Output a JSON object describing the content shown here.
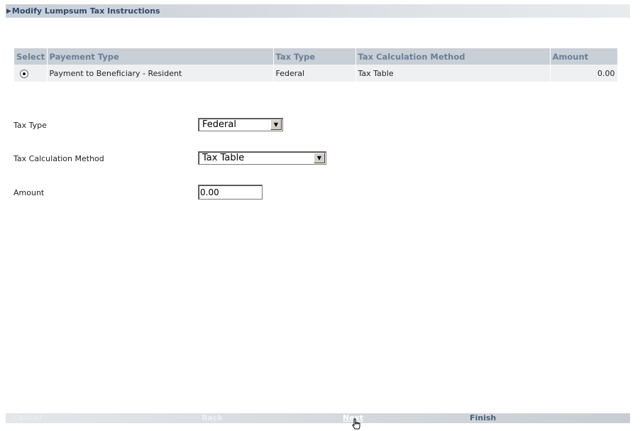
{
  "page": {
    "title": "Modify Lumpsum Tax Instructions"
  },
  "grid": {
    "headers": [
      "Select",
      "Payement Type",
      "Tax Type",
      "Tax Calculation Method",
      "Amount"
    ],
    "rows": [
      {
        "selected": true,
        "payment_type": "Payment to Beneficiary - Resident",
        "tax_type": "Federal",
        "tax_calc_method": "Tax Table",
        "amount": "0.00"
      }
    ]
  },
  "form": {
    "tax_type_label": "Tax Type",
    "tax_type_value": "Federal",
    "tax_calc_label": "Tax Calculation Method",
    "tax_calc_value": "Tax Table",
    "amount_label": "Amount",
    "amount_value": "0.00"
  },
  "footer": {
    "cancel": "Cancel",
    "back": "Back",
    "next": "Next",
    "finish": "Finish"
  },
  "colors": {
    "header_bg": "#c9cfd6",
    "header_text": "#6b7f96",
    "title_text": "#2f4a6b"
  }
}
